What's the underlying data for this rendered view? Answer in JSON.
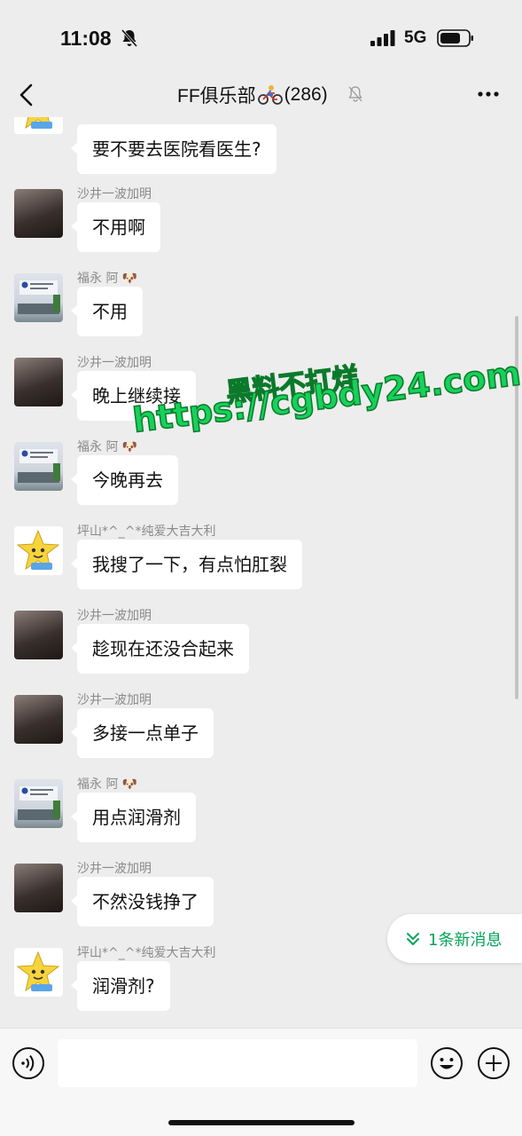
{
  "status_bar": {
    "time": "11:08",
    "network": "5G",
    "icons": [
      "bell-off-icon",
      "signal-icon",
      "battery-icon"
    ]
  },
  "nav": {
    "title": "FF俱乐部",
    "title_emoji": "bike-icon",
    "count": "(286)",
    "icons": [
      "back-icon",
      "mute-icon",
      "more-icon"
    ]
  },
  "messages": [
    {
      "sender": "",
      "text": "要不要去医院看医生?",
      "avatar": "star"
    },
    {
      "sender": "沙井一波加明",
      "text": "不用啊",
      "avatar": "sleep"
    },
    {
      "sender": "福永 阿",
      "text": "不用",
      "avatar": "office"
    },
    {
      "sender": "沙井一波加明",
      "text": "晚上继续接",
      "avatar": "sleep"
    },
    {
      "sender": "福永 阿",
      "text": "今晚再去",
      "avatar": "office"
    },
    {
      "sender": "坪山*^_^*纯爱大吉大利",
      "text": "我搜了一下，有点怕肛裂",
      "avatar": "star"
    },
    {
      "sender": "沙井一波加明",
      "text": "趁现在还没合起来",
      "avatar": "sleep"
    },
    {
      "sender": "沙井一波加明",
      "text": "多接一点单子",
      "avatar": "sleep"
    },
    {
      "sender": "福永 阿",
      "text": "用点润滑剂",
      "avatar": "office"
    },
    {
      "sender": "沙井一波加明",
      "text": "不然没钱挣了",
      "avatar": "sleep"
    },
    {
      "sender": "坪山*^_^*纯爱大吉大利",
      "text": "润滑剂?",
      "avatar": "star"
    }
  ],
  "new_messages_label": "1条新消息",
  "watermark": {
    "line1": "黑料不打烊",
    "line2": "https://cgbdy24.com"
  },
  "input": {
    "value": "",
    "placeholder": ""
  },
  "colors": {
    "background": "#ededed",
    "bubble": "#ffffff",
    "accent_green": "#07a35a",
    "watermark_green": "#16d15a"
  }
}
